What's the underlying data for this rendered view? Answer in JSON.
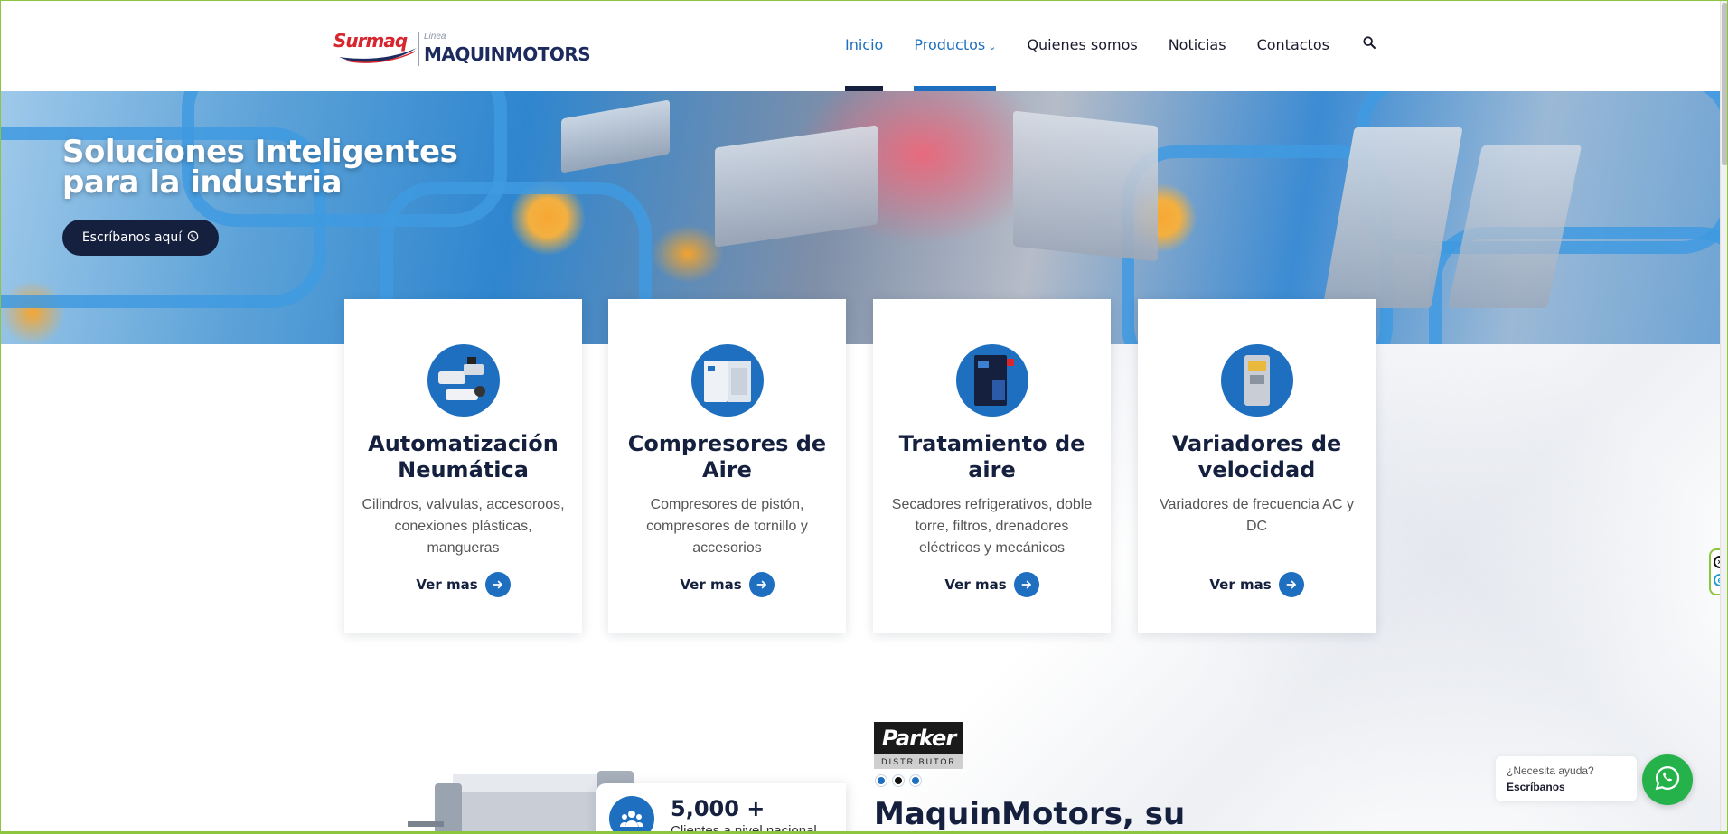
{
  "header": {
    "logo": {
      "surmaq": "Surmaq",
      "linea": "Linea",
      "brand": "MAQUINMOTORS"
    },
    "nav": [
      {
        "label": "Inicio"
      },
      {
        "label": "Productos"
      },
      {
        "label": "Quienes somos"
      },
      {
        "label": "Noticias"
      },
      {
        "label": "Contactos"
      }
    ]
  },
  "hero": {
    "title": "Soluciones Inteligentes\npara la industria",
    "cta": "Escríbanos aquí"
  },
  "cards": [
    {
      "title": "Automatización Neumática",
      "desc": "Cilindros, valvulas, accesoroos, conexiones plásticas, mangueras",
      "more": "Ver mas"
    },
    {
      "title": "Compresores de Aire",
      "desc": "Compresores de pistón, compresores de tornillo y accesorios",
      "more": "Ver mas"
    },
    {
      "title": "Tratamiento de aire",
      "desc": "Secadores refrigerativos, doble torre, filtros, drenadores eléctricos y mecánicos",
      "more": "Ver mas"
    },
    {
      "title": "Variadores de velocidad",
      "desc": "Variadores de frecuencia AC y DC",
      "more": "Ver mas"
    }
  ],
  "bottom": {
    "parker": {
      "name": "Parker",
      "sub": "DISTRIBUTOR"
    },
    "title": "MaquinMotors, su",
    "stat": {
      "number": "5,000 +",
      "label": "Clientes a nivel nacional"
    }
  },
  "whatsapp": {
    "question": "¿Necesita ayuda?",
    "action": "Escríbanos"
  },
  "colors": {
    "primary": "#1e6fbf",
    "navy": "#15203f",
    "whatsapp": "#25b24b"
  }
}
